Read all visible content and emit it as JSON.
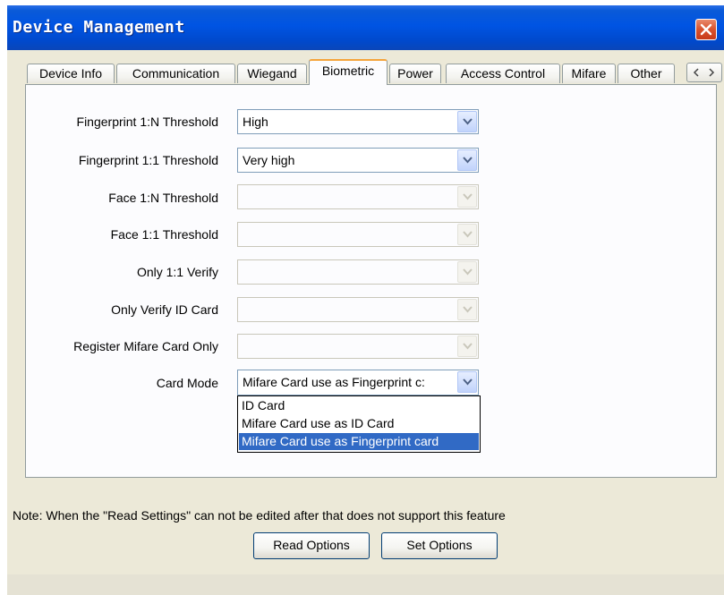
{
  "window": {
    "title": "Device Management"
  },
  "tabs": [
    {
      "label": "Device Info"
    },
    {
      "label": "Communication"
    },
    {
      "label": "Wiegand"
    },
    {
      "label": "Biometric"
    },
    {
      "label": "Power"
    },
    {
      "label": "Access Control"
    },
    {
      "label": "Mifare"
    },
    {
      "label": "Other"
    }
  ],
  "active_tab": "Biometric",
  "fields": [
    {
      "label": "Fingerprint 1:N Threshold",
      "value": "High",
      "enabled": true
    },
    {
      "label": "Fingerprint 1:1 Threshold",
      "value": "Very high",
      "enabled": true
    },
    {
      "label": "Face 1:N Threshold",
      "value": "",
      "enabled": false
    },
    {
      "label": "Face 1:1 Threshold",
      "value": "",
      "enabled": false
    },
    {
      "label": "Only 1:1 Verify",
      "value": "",
      "enabled": false
    },
    {
      "label": "Only Verify ID Card",
      "value": "",
      "enabled": false
    },
    {
      "label": "Register Mifare Card Only",
      "value": "",
      "enabled": false
    },
    {
      "label": "Card Mode",
      "value": "Mifare Card use as Fingerprint c:",
      "enabled": true
    }
  ],
  "card_mode_options": [
    {
      "label": "ID Card",
      "selected": false
    },
    {
      "label": "Mifare Card use as ID Card",
      "selected": false
    },
    {
      "label": "Mifare Card use as Fingerprint card",
      "selected": true
    }
  ],
  "note": "Note: When the \"Read Settings\" can not be edited after that does not support this feature",
  "buttons": {
    "read": "Read Options",
    "set": "Set Options"
  },
  "colors": {
    "titlebar": "#0054e3",
    "selection": "#316ac5",
    "active_tab_accent": "#f5a43b",
    "close": "#d8522e"
  }
}
